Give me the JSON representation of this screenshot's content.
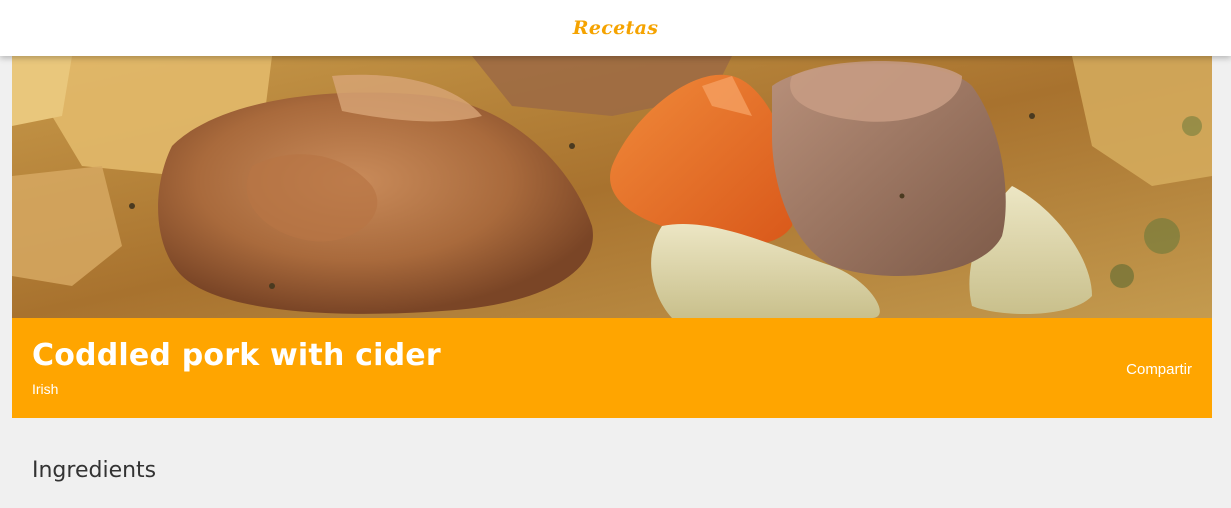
{
  "header": {
    "brand": "Recetas"
  },
  "recipe": {
    "title": "Coddled pork with cider",
    "cuisine": "Irish",
    "share_label": "Compartir",
    "image_subject": "coddled-pork-stew-photo"
  },
  "sections": {
    "ingredients_heading": "Ingredients"
  },
  "colors": {
    "accent": "#ffa500",
    "brand_text": "#f5a300",
    "page_background": "#f0f0f0",
    "header_background": "#ffffff",
    "heading_text": "#333333"
  }
}
